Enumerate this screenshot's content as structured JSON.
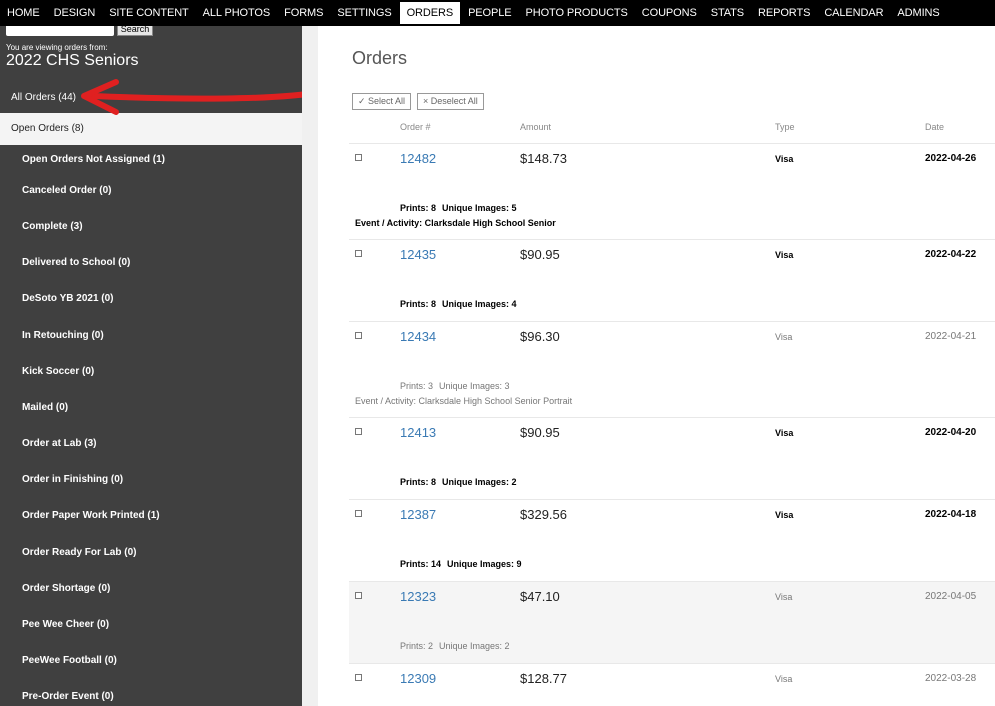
{
  "nav": {
    "items": [
      {
        "label": "HOME",
        "active": false
      },
      {
        "label": "DESIGN",
        "active": false
      },
      {
        "label": "SITE CONTENT",
        "active": false
      },
      {
        "label": "ALL PHOTOS",
        "active": false
      },
      {
        "label": "FORMS",
        "active": false
      },
      {
        "label": "SETTINGS",
        "active": false
      },
      {
        "label": "ORDERS",
        "active": true
      },
      {
        "label": "PEOPLE",
        "active": false
      },
      {
        "label": "PHOTO PRODUCTS",
        "active": false
      },
      {
        "label": "COUPONS",
        "active": false
      },
      {
        "label": "STATS",
        "active": false
      },
      {
        "label": "REPORTS",
        "active": false
      },
      {
        "label": "CALENDAR",
        "active": false
      },
      {
        "label": "ADMINS",
        "active": false
      }
    ]
  },
  "sidebar": {
    "search_button": "Search",
    "viewing_label": "You are viewing orders from:",
    "site_name": "2022 CHS Seniors",
    "all_orders": "All Orders (44)",
    "open_orders": "Open Orders (8)",
    "statuses": [
      "Open Orders Not Assigned (1)",
      "Canceled Order (0)",
      "Complete (3)",
      "Delivered to School (0)",
      "DeSoto YB 2021 (0)",
      "In Retouching (0)",
      "Kick Soccer (0)",
      "Mailed (0)",
      "Order at Lab (3)",
      "Order in Finishing (0)",
      "Order Paper Work Printed (1)",
      "Order Ready For Lab (0)",
      "Order Shortage (0)",
      "Pee Wee Cheer (0)",
      "PeeWee Football (0)",
      "Pre-Order Event (0)"
    ],
    "arrow_color": "#e02020"
  },
  "main": {
    "title": "Orders",
    "select_all": "✓ Select All",
    "deselect_all": "× Deselect All",
    "columns": {
      "order": "Order #",
      "amount": "Amount",
      "type": "Type",
      "date": "Date"
    },
    "link_color": "#3a7ab4",
    "orders": [
      {
        "number": "12482",
        "amount": "$148.73",
        "type": "Visa",
        "date": "2022-04-26",
        "bold": true,
        "prints": "Prints: 8",
        "images": "Unique Images: 5",
        "event": "Event / Activity: Clarksdale High School Senior"
      },
      {
        "number": "12435",
        "amount": "$90.95",
        "type": "Visa",
        "date": "2022-04-22",
        "bold": true,
        "prints": "Prints: 8",
        "images": "Unique Images: 4",
        "event": ""
      },
      {
        "number": "12434",
        "amount": "$96.30",
        "type": "Visa",
        "date": "2022-04-21",
        "bold": false,
        "prints": "Prints: 3",
        "images": "Unique Images: 3",
        "event": "Event / Activity: Clarksdale High School Senior Portrait"
      },
      {
        "number": "12413",
        "amount": "$90.95",
        "type": "Visa",
        "date": "2022-04-20",
        "bold": true,
        "prints": "Prints: 8",
        "images": "Unique Images: 2",
        "event": ""
      },
      {
        "number": "12387",
        "amount": "$329.56",
        "type": "Visa",
        "date": "2022-04-18",
        "bold": true,
        "prints": "Prints: 14",
        "images": "Unique Images: 9",
        "event": ""
      },
      {
        "number": "12323",
        "amount": "$47.10",
        "type": "Visa",
        "date": "2022-04-05",
        "bold": false,
        "prints": "Prints: 2",
        "images": "Unique Images: 2",
        "event": ""
      },
      {
        "number": "12309",
        "amount": "$128.77",
        "type": "Visa",
        "date": "2022-03-28",
        "bold": false,
        "prints": "",
        "images": "",
        "event": ""
      }
    ]
  }
}
